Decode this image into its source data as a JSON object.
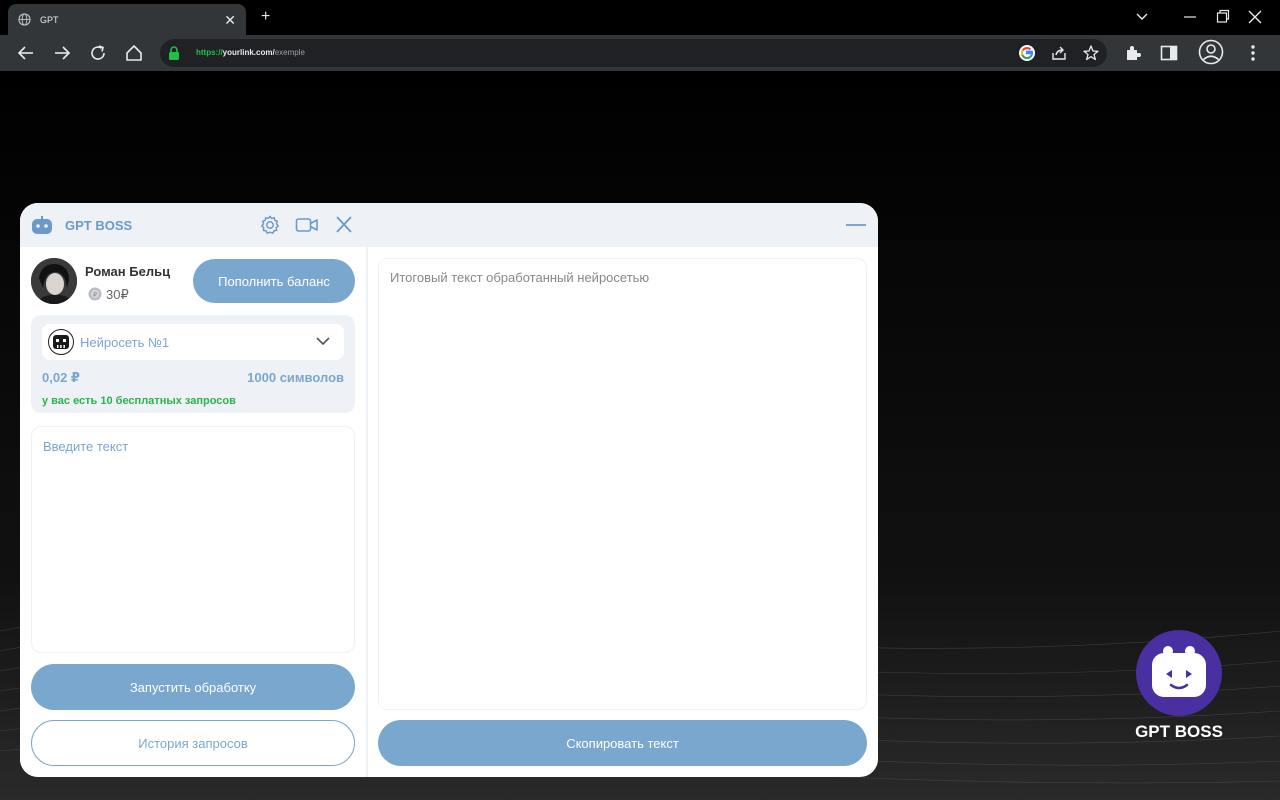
{
  "browser": {
    "tab_title": "GPT",
    "url_scheme": "https://",
    "url_host": "yourlink.com/",
    "url_path": "exemple"
  },
  "app": {
    "brand": "GPT BOSS",
    "user": {
      "name": "Роман Бельц",
      "balance": "30₽"
    },
    "topup_label": "Пополнить баланс",
    "model": {
      "name": "Нейросеть №1",
      "price": "0,02 ₽",
      "chars": "1000 символов",
      "free_requests": "у вас есть 10 бесплатных запросов"
    },
    "input_placeholder": "Введите текст",
    "run_label": "Запустить обработку",
    "history_label": "История запросов",
    "output_placeholder": "Итоговый текст обработанный нейросетью",
    "copy_label": "Скопировать текст"
  },
  "floating_logo_label": "GPT BOSS",
  "colors": {
    "accent": "#7aa7cd",
    "header_bg": "#eef2f7",
    "success": "#2bb24c",
    "logo_bg": "#4a2fa0"
  }
}
